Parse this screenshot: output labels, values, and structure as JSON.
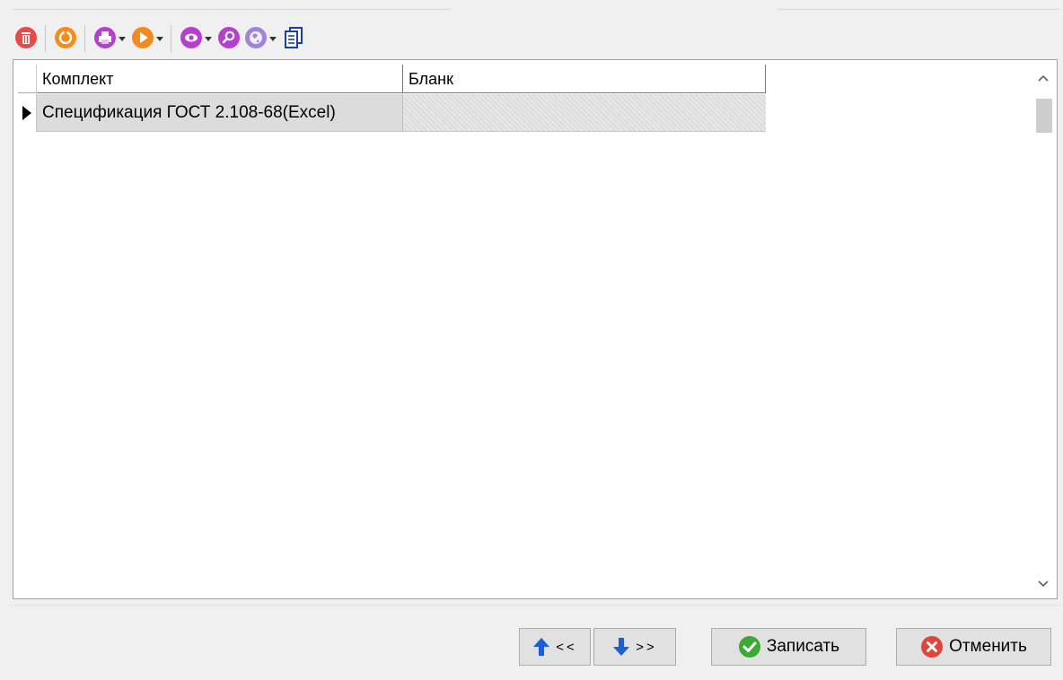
{
  "toolbar": {
    "icons": [
      "delete-icon",
      "refresh-icon",
      "print-icon",
      "run-icon",
      "view-icon",
      "search-icon",
      "globe-icon",
      "clipboard-icon"
    ]
  },
  "grid": {
    "columns": [
      "Комплект",
      "Бланк"
    ],
    "rows": [
      {
        "komplekt": "Спецификация ГОСТ 2.108-68(Excel)",
        "blank": ""
      }
    ],
    "scroll_up_glyph": "^",
    "scroll_down_glyph": "v"
  },
  "footer": {
    "move_up_label": "<<",
    "move_down_label": ">>",
    "save_label": "Записать",
    "cancel_label": "Отменить"
  },
  "colors": {
    "delete": "#e84a4a",
    "refresh": "#f28c1e",
    "print": "#b63fd0",
    "run": "#f28c1e",
    "view": "#b63fd0",
    "search": "#b63fd0",
    "globe": "#a084d8",
    "clipboard": "#1a3fa8",
    "arrow_up": "#1a5fd8",
    "arrow_down": "#1a5fd8",
    "ok": "#3aaa35",
    "cancel": "#e0453a"
  }
}
